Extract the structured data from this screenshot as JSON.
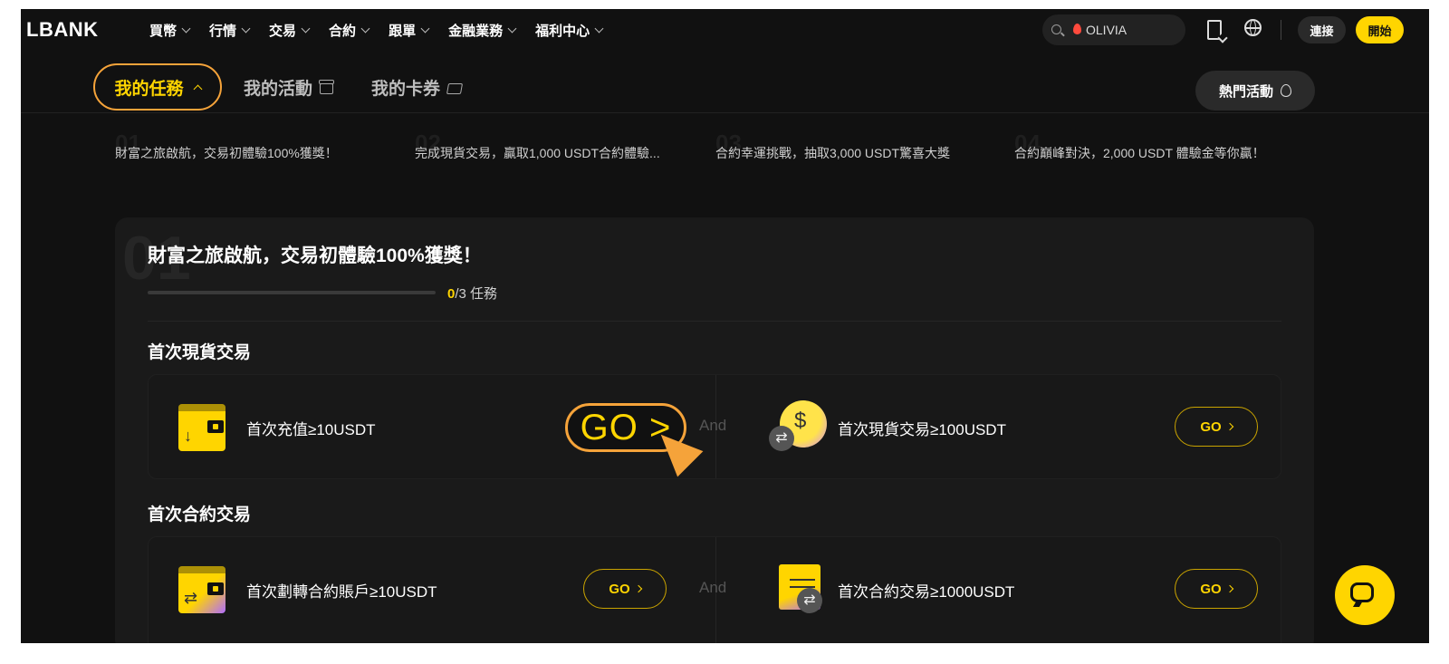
{
  "header": {
    "logo": "LBANK",
    "nav": [
      {
        "label": "買幣"
      },
      {
        "label": "行情"
      },
      {
        "label": "交易"
      },
      {
        "label": "合約"
      },
      {
        "label": "跟單"
      },
      {
        "label": "金融業務"
      },
      {
        "label": "福利中心"
      }
    ],
    "search_placeholder": "OLIVIA",
    "connect_label": "連接",
    "start_label": "開始"
  },
  "tabs": {
    "my_tasks": "我的任務",
    "my_activities": "我的活動",
    "my_coupons": "我的卡券",
    "hot_activities": "熱門活動"
  },
  "steps": [
    {
      "num": "01",
      "label": "財富之旅啟航，交易初體驗100%獲獎！"
    },
    {
      "num": "02",
      "label": "完成現貨交易，贏取1,000 USDT合約體驗..."
    },
    {
      "num": "03",
      "label": "合約幸運挑戰，抽取3,000 USDT驚喜大獎"
    },
    {
      "num": "04",
      "label": "合約巔峰對決，2,000 USDT 體驗金等你贏！"
    }
  ],
  "card": {
    "bignum": "01",
    "title": "財富之旅啟航，交易初體驗100%獲獎！",
    "progress_done": "0",
    "progress_total": "/3 任務",
    "progress_fraction": 0,
    "sections": [
      {
        "title": "首次現貨交易",
        "left_task": "首次充值≥10USDT",
        "right_task": "首次現貨交易≥100USDT",
        "and": "And"
      },
      {
        "title": "首次合約交易",
        "left_task": "首次劃轉合約賬戶≥10USDT",
        "right_task": "首次合約交易≥1000USDT",
        "and": "And"
      }
    ],
    "go_label": "GO",
    "go_big_label": "GO >"
  },
  "colors": {
    "accent": "#ffd500",
    "highlight": "#f5a33a",
    "background": "#111111"
  }
}
